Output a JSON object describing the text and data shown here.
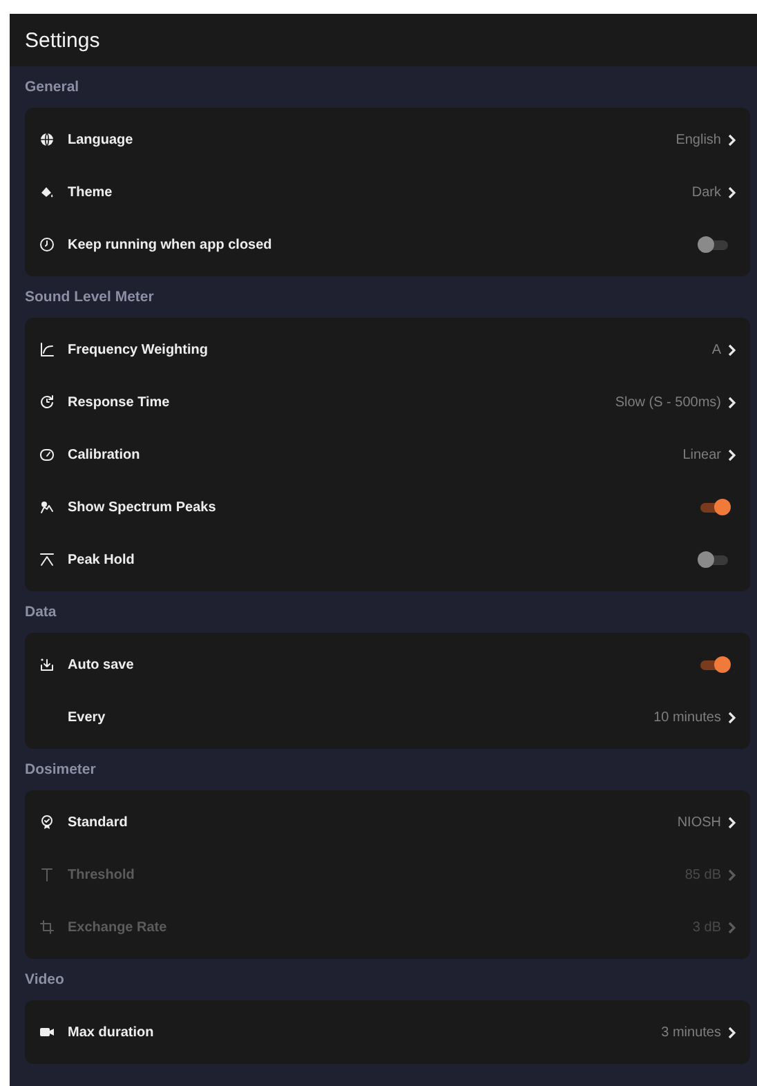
{
  "app_bar": {
    "title": "Settings"
  },
  "sections": [
    {
      "title": "General",
      "rows": [
        {
          "kind": "nav",
          "label": "Language",
          "value": "English",
          "disabled": false
        },
        {
          "kind": "nav",
          "label": "Theme",
          "value": "Dark",
          "disabled": false
        },
        {
          "kind": "toggle",
          "label": "Keep running when app closed",
          "on": false,
          "disabled": false
        }
      ]
    },
    {
      "title": "Sound Level Meter",
      "rows": [
        {
          "kind": "nav",
          "label": "Frequency Weighting",
          "value": "A",
          "disabled": false
        },
        {
          "kind": "nav",
          "label": "Response Time",
          "value": "Slow (S - 500ms)",
          "disabled": false
        },
        {
          "kind": "nav",
          "label": "Calibration",
          "value": "Linear",
          "disabled": false
        },
        {
          "kind": "toggle",
          "label": "Show Spectrum Peaks",
          "on": true,
          "disabled": false
        },
        {
          "kind": "toggle",
          "label": "Peak Hold",
          "on": false,
          "disabled": false
        }
      ]
    },
    {
      "title": "Data",
      "rows": [
        {
          "kind": "toggle",
          "label": "Auto save",
          "on": true,
          "disabled": false
        },
        {
          "kind": "nav",
          "label": "Every",
          "value": "10 minutes",
          "disabled": false
        }
      ]
    },
    {
      "title": "Dosimeter",
      "rows": [
        {
          "kind": "nav",
          "label": "Standard",
          "value": "NIOSH",
          "disabled": false
        },
        {
          "kind": "nav",
          "label": "Threshold",
          "value": "85 dB",
          "disabled": true
        },
        {
          "kind": "nav",
          "label": "Exchange Rate",
          "value": "3 dB",
          "disabled": true
        }
      ]
    },
    {
      "title": "Video",
      "rows": [
        {
          "kind": "nav",
          "label": "Max duration",
          "value": "3 minutes",
          "disabled": false
        }
      ]
    }
  ]
}
